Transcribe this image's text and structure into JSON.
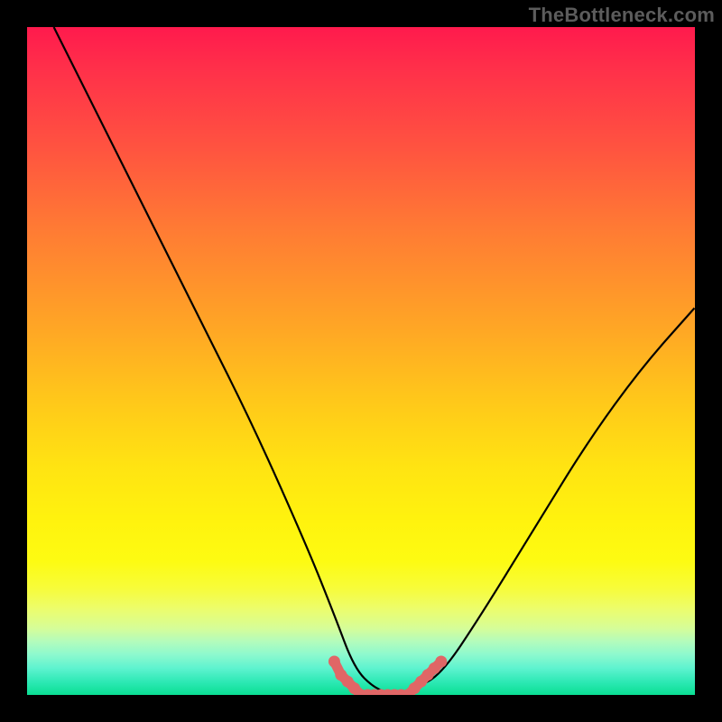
{
  "watermark": "TheBottleneck.com",
  "colors": {
    "background": "#000000",
    "curve": "#000000",
    "marker": "#e06666",
    "gradient_top": "#ff1a4d",
    "gradient_bottom": "#0adf93"
  },
  "chart_data": {
    "type": "line",
    "title": "",
    "xlabel": "",
    "ylabel": "",
    "xlim": [
      0,
      100
    ],
    "ylim": [
      0,
      100
    ],
    "grid": false,
    "legend": false,
    "background": "vertical gradient red→yellow→green (top to bottom)",
    "annotations": [
      {
        "text": "TheBottleneck.com",
        "position": "top-right"
      }
    ],
    "series": [
      {
        "name": "bottleneck-curve",
        "color": "#000000",
        "x": [
          4,
          10,
          18,
          26,
          34,
          42,
          46,
          49,
          52,
          55,
          58,
          62,
          68,
          76,
          84,
          92,
          100
        ],
        "y": [
          100,
          88,
          72,
          56,
          40,
          22,
          12,
          4,
          1,
          0,
          1,
          3,
          12,
          25,
          38,
          49,
          58
        ]
      },
      {
        "name": "optimal-band-markers",
        "color": "#e06666",
        "type": "scatter",
        "x": [
          46,
          47,
          48,
          49,
          50,
          51,
          52,
          53,
          54,
          55,
          56,
          57,
          58,
          59,
          60,
          61,
          62
        ],
        "y": [
          5,
          3,
          2,
          1,
          0,
          0,
          0,
          0,
          0,
          0,
          0,
          0,
          1,
          2,
          3,
          4,
          5
        ]
      }
    ]
  }
}
